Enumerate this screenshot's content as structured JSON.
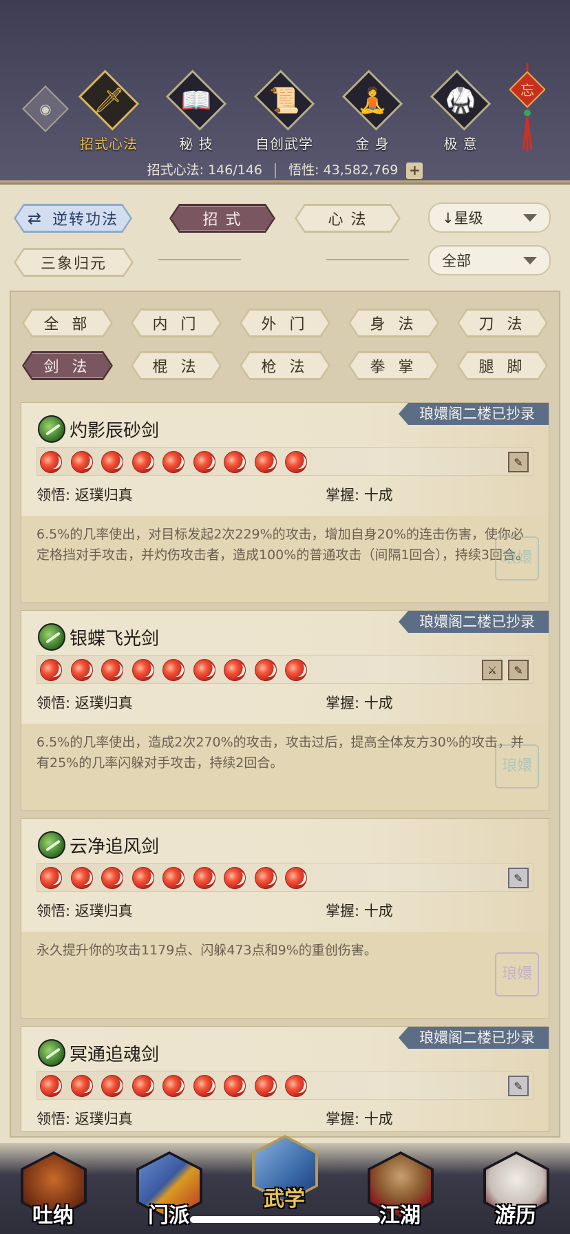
{
  "header": {
    "tabs": [
      {
        "label": "招式心法",
        "icon": "sword-icon",
        "glyph": "🗡",
        "active": true
      },
      {
        "label": "秘 技",
        "icon": "book-icon",
        "glyph": "📖",
        "active": false
      },
      {
        "label": "自创武学",
        "icon": "scroll-icon",
        "glyph": "📜",
        "active": false
      },
      {
        "label": "金 身",
        "icon": "meditation-icon",
        "glyph": "🧘",
        "active": false
      },
      {
        "label": "极 意",
        "icon": "martial-pose-icon",
        "glyph": "🥋",
        "active": false
      }
    ],
    "knot_char": "忘",
    "stats_label_1": "招式心法: 146/146",
    "stats_label_2": "悟性: 43,582,769",
    "plus": "+"
  },
  "controls": {
    "reverse_btn": "逆转功法",
    "reverse_icon": "⇄",
    "moves_btn": "招 式",
    "heart_btn": "心 法",
    "sort_dropdown": "↓星级",
    "sanxiang_btn": "三象归元",
    "filter_dropdown": "全部"
  },
  "filters": [
    "全 部",
    "内 门",
    "外 门",
    "身 法",
    "刀 法",
    "剑 法",
    "棍 法",
    "枪 法",
    "拳 掌",
    "腿 脚"
  ],
  "active_filter": "剑 法",
  "skills": [
    {
      "name": "灼影辰砂剑",
      "banner": "琅嬛阁二楼已抄录",
      "stars": 9,
      "insight_label": "领悟:  返璞归真",
      "mastery_label": "掌握:  十成",
      "desc": "6.5%的几率使出，对目标发起2次229%的攻击，增加自身20%的连击伤害，使你必定格挡对手攻击，并灼伤攻击者，造成100%的普通攻击（间隔1回合），持续3回合。",
      "seal_color": "#8fb8b8",
      "scroll_icons": [
        "✎"
      ]
    },
    {
      "name": "银蝶飞光剑",
      "banner": "琅嬛阁二楼已抄录",
      "stars": 9,
      "insight_label": "领悟:  返璞归真",
      "mastery_label": "掌握:  十成",
      "desc": "6.5%的几率使出，造成2次270%的攻击，攻击过后，提高全体友方30%的攻击，并有25%的几率闪躲对手攻击，持续2回合。",
      "seal_color": "#8fb8b8",
      "scroll_icons": [
        "⚔",
        "✎"
      ]
    },
    {
      "name": "云净追风剑",
      "banner": "",
      "stars": 9,
      "insight_label": "领悟:  返璞归真",
      "mastery_label": "掌握:  十成",
      "desc": "永久提升你的攻击1179点、闪躲473点和9%的重创伤害。",
      "seal_color": "#a89ad0",
      "scroll_icons": [
        "✎"
      ]
    },
    {
      "name": "冥通追魂剑",
      "banner": "琅嬛阁二楼已抄录",
      "stars": 9,
      "insight_label": "领悟:  返璞归真",
      "mastery_label": "掌握:  十成",
      "desc": "",
      "seal_color": "#8fb8b8",
      "scroll_icons": [
        "✎"
      ]
    }
  ],
  "bottom_nav": [
    {
      "label": "吐纳",
      "icon": "monk-icon",
      "color": "#8a3a18",
      "active": false
    },
    {
      "label": "门派",
      "icon": "sect-banner-icon",
      "color": "#4a6aa8",
      "active": false
    },
    {
      "label": "武学",
      "icon": "martial-book-icon",
      "color": "#3c6aa8",
      "active": true
    },
    {
      "label": "江湖",
      "icon": "straw-hat-icon",
      "color": "#8a2a2a",
      "active": false
    },
    {
      "label": "游历",
      "icon": "horse-icon",
      "color": "#b8b0a8",
      "active": false
    }
  ]
}
